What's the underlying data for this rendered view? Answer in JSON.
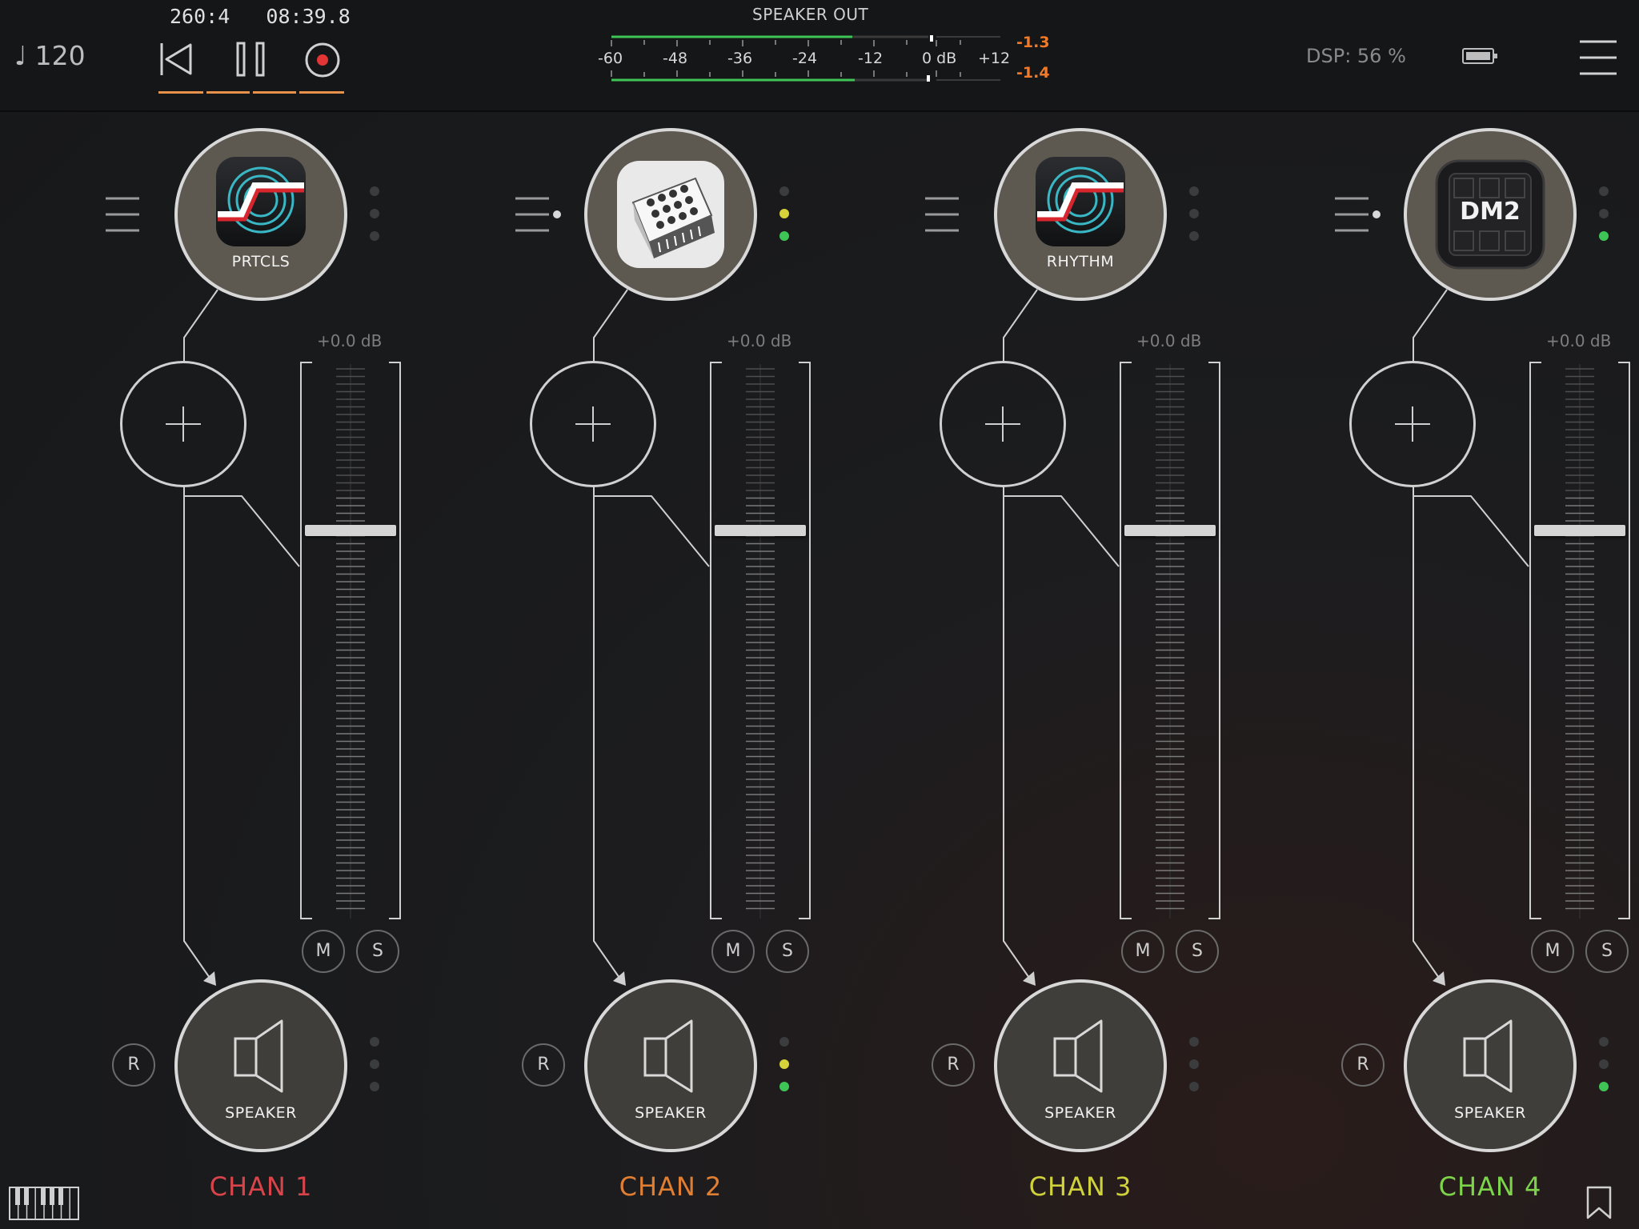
{
  "transport": {
    "tempo": "120",
    "tempo_icon": "quarter-note-icon",
    "position": "260:4",
    "time": "08:39.8",
    "rewind_icon": "rewind-icon",
    "pause_icon": "pause-icon",
    "record_icon": "record-icon"
  },
  "speaker_out": {
    "label": "SPEAKER OUT",
    "scale": [
      "-60",
      "-48",
      "-36",
      "-24",
      "-12",
      "0 dB",
      "+12"
    ],
    "peak_left": "-1.3",
    "peak_right": "-1.4",
    "level_left_db": -18,
    "level_right_db": -18
  },
  "status": {
    "dsp": "DSP: 56 %",
    "battery_icon": "battery-icon",
    "menu_icon": "hamburger-menu-icon"
  },
  "channels": [
    {
      "name": "CHAN 1",
      "color": "#d9444a",
      "plugin_label": "PRTCLS",
      "plugin_icon": "particles-app-icon",
      "gain": "+0.0 dB",
      "fader_level": 0.7,
      "mute": "M",
      "solo": "S",
      "output": "SPEAKER",
      "record": "R"
    },
    {
      "name": "CHAN 2",
      "color": "#e07e32",
      "plugin_label": "",
      "plugin_icon": "synthesizer-app-icon",
      "gain": "+0.0 dB",
      "fader_level": 0.7,
      "mute": "M",
      "solo": "S",
      "output": "SPEAKER",
      "record": "R"
    },
    {
      "name": "CHAN 3",
      "color": "#cfd23a",
      "plugin_label": "RHYTHM",
      "plugin_icon": "particles-app-icon",
      "gain": "+0.0 dB",
      "fader_level": 0.7,
      "mute": "M",
      "solo": "S",
      "output": "SPEAKER",
      "record": "R"
    },
    {
      "name": "CHAN 4",
      "color": "#7dd44a",
      "plugin_label": "",
      "plugin_icon": "dm2-app-icon",
      "plugin_logo_text": "DM2",
      "gain": "+0.0 dB",
      "fader_level": 0.7,
      "mute": "M",
      "solo": "S",
      "output": "SPEAKER",
      "record": "R"
    }
  ],
  "footer": {
    "keyboard_icon": "piano-keyboard-icon",
    "bookmark_icon": "bookmark-icon"
  }
}
